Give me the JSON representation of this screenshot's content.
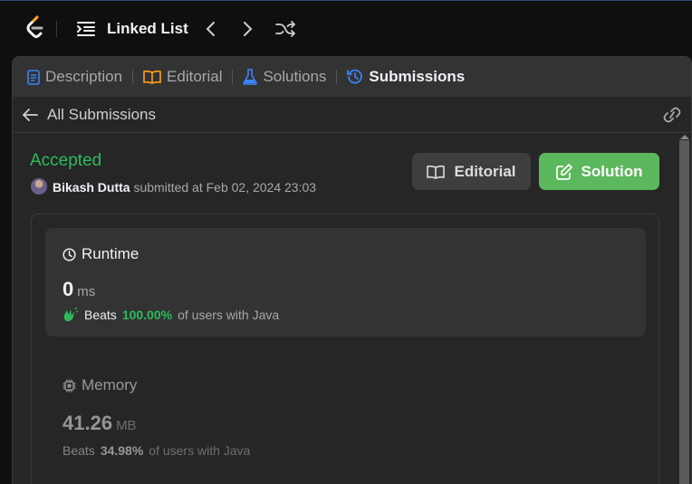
{
  "topbar": {
    "problem_title": "Linked List"
  },
  "tabs": [
    {
      "label": "Description"
    },
    {
      "label": "Editorial"
    },
    {
      "label": "Solutions"
    },
    {
      "label": "Submissions"
    }
  ],
  "subheader": {
    "back_label": "All Submissions"
  },
  "submission": {
    "status": "Accepted",
    "user": "Bikash Dutta",
    "submitted_text": "submitted at Feb 02, 2024 23:03",
    "editorial_button": "Editorial",
    "solution_button": "Solution"
  },
  "runtime": {
    "title": "Runtime",
    "value": "0",
    "unit": "ms",
    "beats_label": "Beats",
    "beats_pct": "100.00%",
    "beats_suffix": "of users with Java"
  },
  "memory": {
    "title": "Memory",
    "value": "41.26",
    "unit": "MB",
    "beats_label": "Beats",
    "beats_pct": "34.98%",
    "beats_suffix": "of users with Java"
  },
  "colors": {
    "accent_green": "#2cbb5d",
    "solution_button": "#5cb85c",
    "active_tab_icon": "#3b82f6"
  }
}
